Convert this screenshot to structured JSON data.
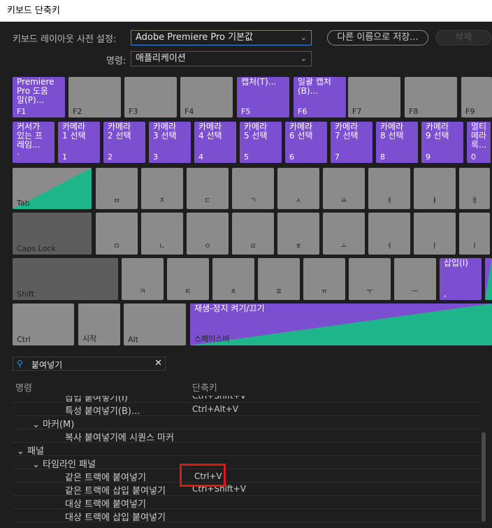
{
  "window": {
    "title": "키보드 단축키"
  },
  "toolbar": {
    "layout_label": "키보드 레이아웃 사전 설정:",
    "layout_value": "Adobe Premiere Pro 기본값",
    "save_as": "다른 이름으로 저장...",
    "delete": "삭제",
    "command_label": "명령:",
    "command_value": "애플리케이션"
  },
  "keyboard": {
    "row_f": [
      {
        "top": "Premiere\nPro 도움\n말(P)...",
        "bottom": "F1",
        "color": "purple"
      },
      {
        "top": "",
        "bottom": "F2",
        "color": "gray"
      },
      {
        "top": "",
        "bottom": "F3",
        "color": "gray"
      },
      {
        "top": "",
        "bottom": "F4",
        "color": "gray"
      },
      {
        "top": "캡처(T)...",
        "bottom": "F5",
        "color": "purple"
      },
      {
        "top": "일괄 캡처\n(B)...",
        "bottom": "F6",
        "color": "purple"
      },
      {
        "top": "",
        "bottom": "F7",
        "color": "gray"
      },
      {
        "top": "",
        "bottom": "F8",
        "color": "gray"
      },
      {
        "top": "",
        "bottom": "F9",
        "color": "gray"
      }
    ],
    "row_num": [
      {
        "top": "커서가\n있는 프\n레임...",
        "bottom": "`",
        "color": "purple"
      },
      {
        "top": "카메라\n1 선택",
        "bottom": "1",
        "color": "purple"
      },
      {
        "top": "카메라\n2 선택",
        "bottom": "2",
        "color": "purple"
      },
      {
        "top": "카메라\n3 선택",
        "bottom": "3",
        "color": "purple"
      },
      {
        "top": "카메라\n4 선택",
        "bottom": "4",
        "color": "purple"
      },
      {
        "top": "카메라\n5 선택",
        "bottom": "5",
        "color": "purple"
      },
      {
        "top": "카메라\n6 선택",
        "bottom": "6",
        "color": "purple"
      },
      {
        "top": "카메라\n7 선택",
        "bottom": "7",
        "color": "purple"
      },
      {
        "top": "카메라\n8 선택",
        "bottom": "8",
        "color": "purple"
      },
      {
        "top": "카메라\n9 선택",
        "bottom": "9",
        "color": "purple"
      },
      {
        "top": "멀티\n메라\n록...",
        "bottom": "0",
        "color": "purple"
      }
    ],
    "row_q": {
      "mod": "Tab",
      "keys": [
        "ㅂ",
        "ㅈ",
        "ㄷ",
        "ㄱ",
        "ㅅ",
        "ㅛ",
        "ㅕ",
        "ㅑ",
        "ㅐ"
      ]
    },
    "row_a": {
      "mod": "Caps Lock",
      "keys": [
        "ㅁ",
        "ㄴ",
        "ㅇ",
        "ㄹ",
        "ㅎ",
        "ㅗ",
        "ㅓ",
        "ㅏ",
        "ㅣ"
      ]
    },
    "row_z": {
      "mod": "Shift",
      "keys": [
        "ㅋ",
        "ㅌ",
        "ㅊ",
        "ㅍ",
        "ㅠ",
        "ㅜ",
        "ㅡ"
      ],
      "insert_top": "삽입(I)",
      "insert_bottom": ","
    },
    "row_space": {
      "ctrl": "Ctrl",
      "start": "시작",
      "alt": "Alt",
      "space_top": "재생-정지 켜기/끄기",
      "space_bottom": "스페이스바"
    }
  },
  "search": {
    "value": "붙여넣기"
  },
  "table": {
    "col_name": "명령",
    "col_shortcut": "단축키",
    "rows": [
      {
        "name": "삽입 붙여넣기(I)",
        "shortcut": "Ctrl+Shift+V"
      },
      {
        "name": "특성 붙여넣기(B)...",
        "shortcut": "Ctrl+Alt+V"
      },
      {
        "name": "⌄  마커(M)",
        "shortcut": ""
      },
      {
        "name": "복사 붙여넣기에 시퀀스 마커",
        "shortcut": ""
      },
      {
        "name": "⌄  패널",
        "shortcut": ""
      },
      {
        "name": "⌄  타임라인 패널",
        "shortcut": ""
      },
      {
        "name": "같은 트랙에 붙여넣기",
        "shortcut": "Ctrl+V"
      },
      {
        "name": "같은 트랙에 삽입 붙여넣기",
        "shortcut": "Ctrl+Shift+V"
      },
      {
        "name": "대상 트랙에 붙여넣기",
        "shortcut": ""
      },
      {
        "name": "대상 트랙에 삽입 붙여넣기",
        "shortcut": ""
      }
    ]
  },
  "colors": {
    "purple": "#7b4fcf",
    "green": "#1fb58a",
    "gray": "#8b8b8b",
    "highlight": "#e0141b"
  }
}
